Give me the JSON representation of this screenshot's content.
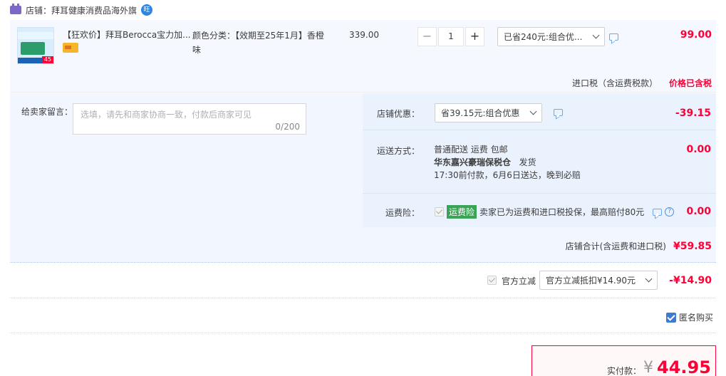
{
  "shop": {
    "label": "店铺：",
    "name": "拜耳健康消费品海外旗",
    "wang_badge": "旺"
  },
  "item": {
    "thumb_badge": "45",
    "title": "【狂欢价】拜耳Berocca宝力加...",
    "sku_label": "颜色分类：",
    "sku_value": "【效期至25年1月】香橙味",
    "unit_price": "339.00",
    "qty_minus": "−",
    "qty": "1",
    "qty_plus": "+",
    "promo": "已省240元:组合优...",
    "total": "99.00",
    "tax_label": "进口税（含运费税款）",
    "tax_value": "价格已含税"
  },
  "message": {
    "label": "给卖家留言：",
    "placeholder": "选填，请先和商家协商一致，付款后商家可见",
    "count": "0/200"
  },
  "coupon": {
    "label": "店铺优惠：",
    "value": "省39.15元:组合优惠",
    "amount": "-39.15"
  },
  "shipping": {
    "label": "运送方式：",
    "line1": "普通配送 运费 包邮",
    "warehouse": "华东嘉兴豪瑞保税仓",
    "deliver": "发货",
    "line3": "17:30前付款，6月6日送达，晚到必赔",
    "amount": "0.00"
  },
  "insurance": {
    "label": "运费险：",
    "badge": "运费险",
    "text": "卖家已为运费和进口税投保，最高赔付80元",
    "help": "?",
    "amount": "0.00"
  },
  "shop_total": {
    "label": "店铺合计(含运费和进口税)",
    "value": "¥59.85"
  },
  "official": {
    "label": "官方立减",
    "select": "官方立减抵扣¥14.90元",
    "amount": "-¥14.90"
  },
  "anonymous": {
    "label": "匿名购买"
  },
  "payment": {
    "label": "实付款：",
    "currency": "¥",
    "amount": "44.95"
  }
}
